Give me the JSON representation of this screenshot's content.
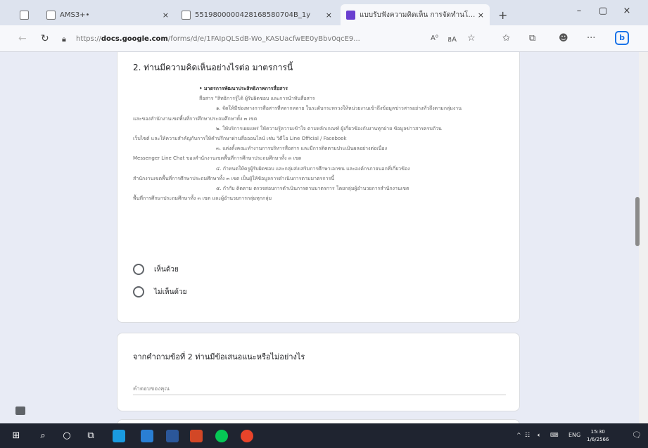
{
  "browser": {
    "tabs": [
      {
        "title": "AMS3+•",
        "close": "×",
        "active": false
      },
      {
        "title": "5519800000428168580704B_1y",
        "close": "×",
        "active": false
      },
      {
        "title": "แบบรับฟังความคิดเห็น การจัดทำนโยบาย",
        "close": "×",
        "active": true
      }
    ],
    "new_tab": "+",
    "window_controls": {
      "minimize": "–",
      "maximize": "▢",
      "close": "×"
    },
    "url_prefix": "https://",
    "url_host": "docs.google.com",
    "url_path": "/forms/d/e/1FAIpQLSdB-Wo_KASUacfwEE0yBbv0qcE9...",
    "toolbar_labels": {
      "read_aloud": "A⁰",
      "translate": "ฮA",
      "more": "···"
    }
  },
  "form": {
    "question1": {
      "title": "2. ท่านมีความคิดเห็นอย่างไรต่อ มาตรการนี้",
      "policy_lines": [
        {
          "cls": "hd",
          "text": "• มาตรการพัฒนาประสิทธิภาพการสื่อสาร"
        },
        {
          "cls": "ind",
          "text": "สื่อสาร \"สิทธิการรู้ได้ ผู้รับผิดชอบ และการนำทันสื่อสาร"
        },
        {
          "cls": "ind2",
          "text": "๑. จัดให้มีช่องทางการสื่อสารที่หลากหลาย ในระดับกระทรวงให้หน่วยงานเข้าถึงข้อมูลข่าวสารอย่างทั่วถึงตามกลุ่มงาน"
        },
        {
          "cls": "",
          "text": "และของสำนักงานเขตพื้นที่การศึกษาประถมศึกษาทั้ง ๓ เขต"
        },
        {
          "cls": "ind2",
          "text": "๒. ให้บริการเผยแพร่ ให้ความรู้ความเข้าใจ ตามหลักเกณฑ์ ผู้เกี่ยวข้องกับงานทุกฝ่าย ข้อมูลข่าวสารครบถ้วน"
        },
        {
          "cls": "",
          "text": "เว็บไซต์ และให้ความสำคัญกับการให้คำปรึกษาผ่านสื่อออนไลน์ เช่น วิดีโอ Line Official / Facebook"
        },
        {
          "cls": "ind2",
          "text": "๓. แต่งตั้งคณะทำงานการบริหารสื่อสาร และมีการติดตามประเมินผลอย่างต่อเนื่อง"
        },
        {
          "cls": "",
          "text": "Messenger Line Chat ของสำนักงานเขตพื้นที่การศึกษาประถมศึกษาทั้ง ๓ เขต"
        },
        {
          "cls": "ind2",
          "text": "๔. กำหนดให้ครูผู้รับผิดชอบ และกลุ่มส่งเสริมการศึกษาเอกชน และองค์กรภายนอกที่เกี่ยวข้อง"
        },
        {
          "cls": "",
          "text": "สำนักงานเขตพื้นที่การศึกษาประถมศึกษาทั้ง ๓ เขต เป็นผู้ให้ข้อมูลการดำเนินการตามมาตรการนี้"
        },
        {
          "cls": "ind2",
          "text": "๕. กำกับ ติดตาม ตรวจสอบการดำเนินการตามมาตรการ โดยกลุ่มผู้อำนวยการสำนักงานเขต"
        },
        {
          "cls": "",
          "text": "พื้นที่การศึกษาประถมศึกษาทั้ง ๓ เขต และผู้อำนวยการกลุ่มทุกกลุ่ม"
        }
      ],
      "options": [
        {
          "label": "เห็นด้วย"
        },
        {
          "label": "ไม่เห็นด้วย"
        }
      ]
    },
    "question2": {
      "title": "จากคำถามข้อที่ 2 ท่านมีข้อเสนอแนะหรือไม่อย่างไร",
      "placeholder": "คำตอบของคุณ"
    }
  },
  "taskbar": {
    "tray_language": "ENG",
    "time": "15:30",
    "date": "1/6/2566"
  },
  "colors": {
    "page_background": "#e8ebf5",
    "card_background": "#ffffff",
    "taskbar": "#1f2430"
  }
}
